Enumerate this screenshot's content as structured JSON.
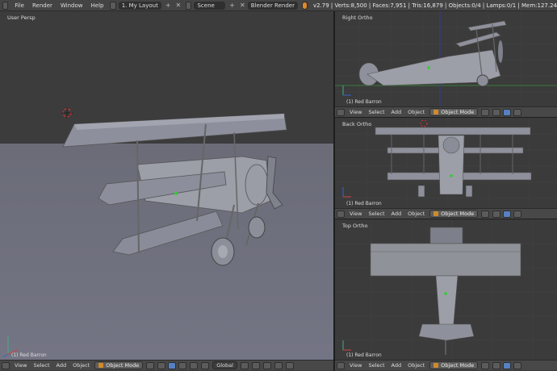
{
  "topbar": {
    "menu": [
      "File",
      "Render",
      "Window",
      "Help"
    ],
    "layout": "1. My Layout",
    "scene": "Scene",
    "engine": "Blender Render",
    "stats": "v2.79 | Verts:8,500 | Faces:7,951 | Tris:16,879 | Objects:0/4 | Lamps:0/1 | Mem:127.24"
  },
  "viewports": {
    "persp": {
      "label": "User Persp",
      "object": "(1) Red Barron"
    },
    "right": {
      "label": "Right Ortho",
      "object": "(1) Red Barron"
    },
    "back": {
      "label": "Back Ortho",
      "object": "(1) Red Barron"
    },
    "top": {
      "label": "Top Ortho",
      "object": "(1) Red Barron"
    }
  },
  "header": {
    "view": "View",
    "select": "Select",
    "add": "Add",
    "object": "Object",
    "mode": "Object Mode",
    "orientation": "Global"
  },
  "colors": {
    "accent": "#5680c2",
    "object_mode": "#d08a2a",
    "grid_x": "#7a3a3a",
    "grid_y": "#3a7a3a"
  }
}
